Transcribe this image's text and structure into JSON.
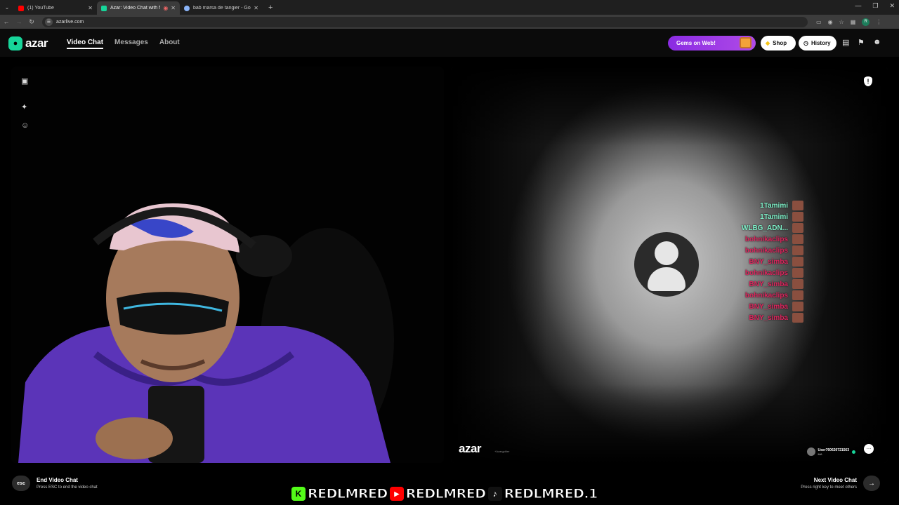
{
  "browser": {
    "tabs": [
      {
        "title": "(1) YouTube",
        "color": "#ff0000",
        "active": false
      },
      {
        "title": "Azar: Video Chat with New",
        "color": "#17d59a",
        "active": true
      },
      {
        "title": "bab marsa de tangier - Google",
        "color": "#8ab4f8",
        "active": false
      }
    ],
    "url": "azarlive.com",
    "profile_initial": "R"
  },
  "header": {
    "logo": "azar",
    "nav": [
      "Video Chat",
      "Messages",
      "About"
    ],
    "gems": "Gems on Web!",
    "shop": "Shop",
    "history": "History"
  },
  "peer": {
    "logo": "azar",
    "subtitle": "+Azargylder",
    "username": "User760620721563",
    "country": "MA"
  },
  "chat": [
    {
      "name": "1Tamimi",
      "color": "#7ef0c8"
    },
    {
      "name": "1Tamimi",
      "color": "#7ef0c8"
    },
    {
      "name": "WLBG_ADN...",
      "color": "#7ef0c8"
    },
    {
      "name": "bohnikaclips",
      "color": "#e0245e"
    },
    {
      "name": "bohnikaclips",
      "color": "#e0245e"
    },
    {
      "name": "BNY_simba",
      "color": "#e0245e"
    },
    {
      "name": "bohnikaclips",
      "color": "#e0245e"
    },
    {
      "name": "BNY_simba",
      "color": "#e0245e"
    },
    {
      "name": "bohnikaclips",
      "color": "#e0245e"
    },
    {
      "name": "BNY_simba",
      "color": "#e0245e"
    },
    {
      "name": "BNY_simba",
      "color": "#e0245e"
    }
  ],
  "footer": {
    "esc": "esc",
    "end_title": "End Video Chat",
    "end_sub": "Press ESC to end the video chat",
    "next_title": "Next Video Chat",
    "next_sub": "Press right key to meet others"
  },
  "banner": {
    "kick": "REDLMRED",
    "youtube": "REDLMRED",
    "tiktok": "REDLMRED.1"
  }
}
